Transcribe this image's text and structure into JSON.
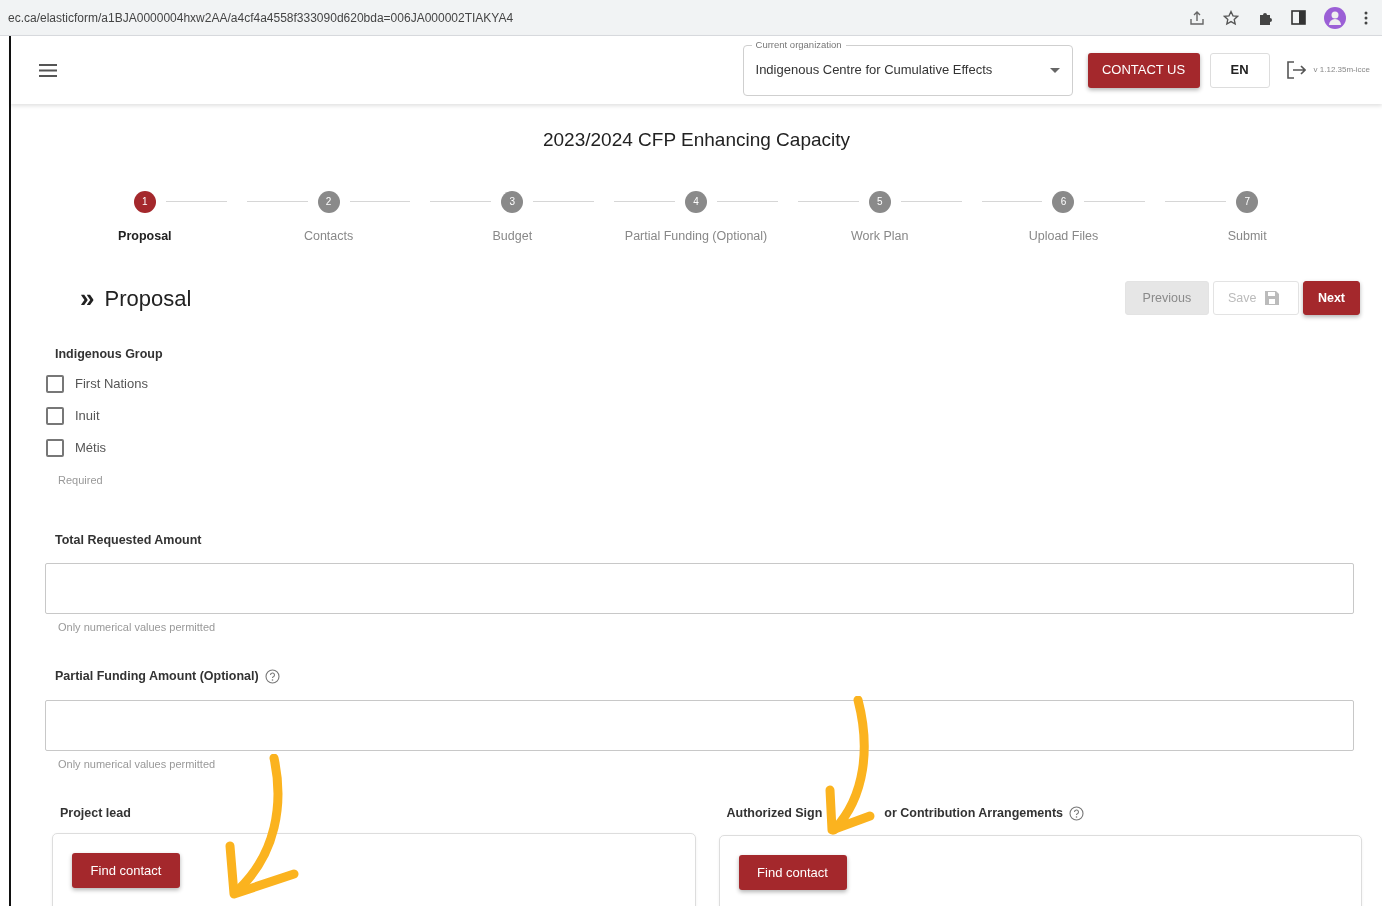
{
  "browser": {
    "url": "ec.ca/elasticform/a1BJA0000004hxw2AA/a4cf4a4558f333090d620bda=006JA000002TIAKYA4"
  },
  "header": {
    "org_select": {
      "legend": "Current organization",
      "value": "Indigenous Centre for Cumulative Effects"
    },
    "contact_button": "CONTACT US",
    "language_button": "EN",
    "version": "v 1.12.35m-icce"
  },
  "title": "2023/2024 CFP Enhancing Capacity",
  "steps": [
    {
      "number": "1",
      "label": "Proposal",
      "selected": true
    },
    {
      "number": "2",
      "label": "Contacts",
      "selected": false
    },
    {
      "number": "3",
      "label": "Budget",
      "selected": false
    },
    {
      "number": "4",
      "label": "Partial Funding (Optional)",
      "selected": false
    },
    {
      "number": "5",
      "label": "Work Plan",
      "selected": false
    },
    {
      "number": "6",
      "label": "Upload Files",
      "selected": false
    },
    {
      "number": "7",
      "label": "Submit",
      "selected": false
    }
  ],
  "section": {
    "marker": "»",
    "heading": "Proposal"
  },
  "nav_buttons": [
    {
      "label": "Previous",
      "kind": "plain",
      "disabled": true
    },
    {
      "label": "Save",
      "kind": "save",
      "disabled": true
    },
    {
      "label": "Next",
      "kind": "plain",
      "disabled": false
    }
  ],
  "indigenous_group": {
    "label": "Indigenous Group",
    "options": [
      {
        "label": "First Nations",
        "checked": false
      },
      {
        "label": "Inuit",
        "checked": false
      },
      {
        "label": "Métis",
        "checked": false
      }
    ],
    "helper": "Required"
  },
  "amount_fields": [
    {
      "label": "Total Requested Amount",
      "help_icon": false,
      "helper": "Only numerical values permitted"
    },
    {
      "label": "Partial Funding Amount (Optional)",
      "help_icon": true,
      "helper": "Only numerical values permitted"
    }
  ],
  "contact_fields": [
    {
      "label_parts": [
        "Project lead"
      ],
      "help_icon": false,
      "button": "Find contact"
    },
    {
      "label_parts": [
        "Authorized Sign",
        "or Contribution Arrangements"
      ],
      "help_icon": true,
      "button": "Find contact"
    }
  ]
}
